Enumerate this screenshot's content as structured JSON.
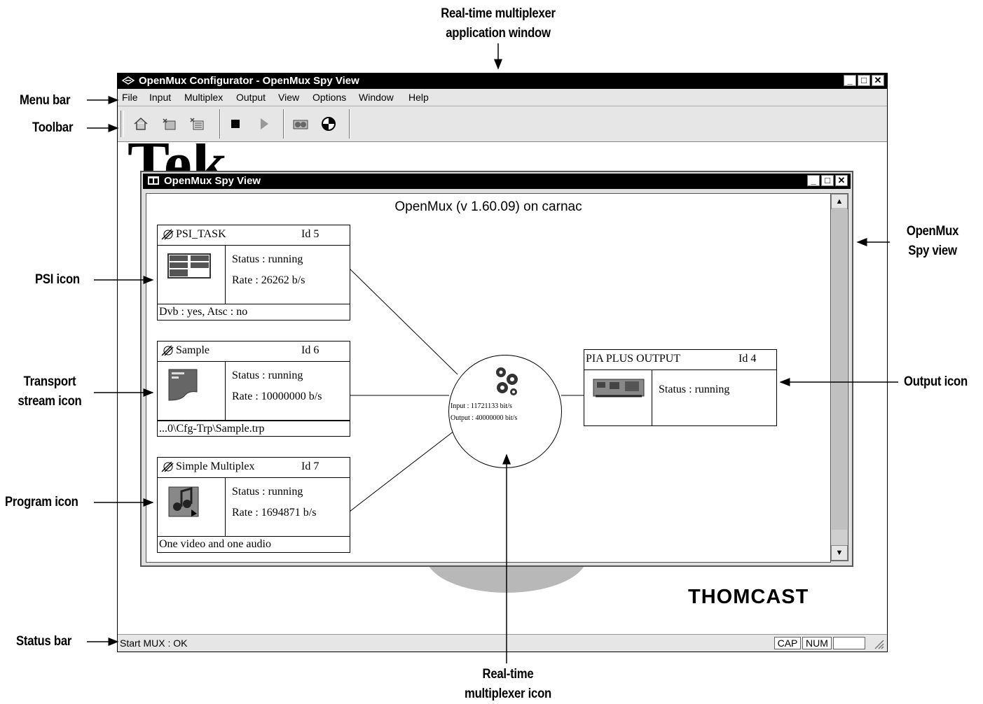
{
  "callouts": {
    "app_window": "Real-time multiplexer\napplication window",
    "menu_bar": "Menu bar",
    "toolbar": "Toolbar",
    "psi_icon": "PSI icon",
    "transport_stream_icon": "Transport\nstream icon",
    "program_icon": "Program icon",
    "status_bar": "Status bar",
    "spy_view": "OpenMux\nSpy view",
    "output_icon": "Output icon",
    "mux_icon": "Real-time\nmultiplexer icon"
  },
  "app": {
    "title": "OpenMux Configurator - OpenMux Spy View",
    "menu": [
      "File",
      "Input",
      "Multiplex",
      "Output",
      "View",
      "Options",
      "Window",
      "Help"
    ],
    "toolbar_icons": [
      "home-icon",
      "add-input-icon",
      "configure-icon",
      "stop-icon",
      "play-icon",
      "spy-binoculars-icon",
      "statistics-pie-icon"
    ],
    "background_brand": "THOMCAST",
    "status": {
      "message": "Start MUX : OK",
      "cap": "CAP",
      "num": "NUM",
      "empty": ""
    }
  },
  "spy": {
    "title": "OpenMux Spy View",
    "heading": "OpenMux (v 1.60.09) on carnac",
    "nodes": {
      "psi": {
        "name": "PSI_TASK",
        "id": "Id 5",
        "status": "Status : running",
        "rate": "Rate : 26262 b/s",
        "footer": "Dvb : yes, Atsc : no"
      },
      "sample": {
        "name": "Sample",
        "id": "Id 6",
        "status": "Status : running",
        "rate": "Rate : 10000000 b/s",
        "footer": "...0\\Cfg-Trp\\Sample.trp"
      },
      "program": {
        "name": "Simple Multiplex",
        "id": "Id 7",
        "status": "Status : running",
        "rate": "Rate : 1694871 b/s",
        "footer": "One video and one audio"
      },
      "output": {
        "name": "PIA PLUS OUTPUT",
        "id": "Id 4",
        "status": "Status : running"
      }
    },
    "mux": {
      "input": "Input : 11721133 bit/s",
      "output": "Output : 40000000 bit/s"
    }
  }
}
